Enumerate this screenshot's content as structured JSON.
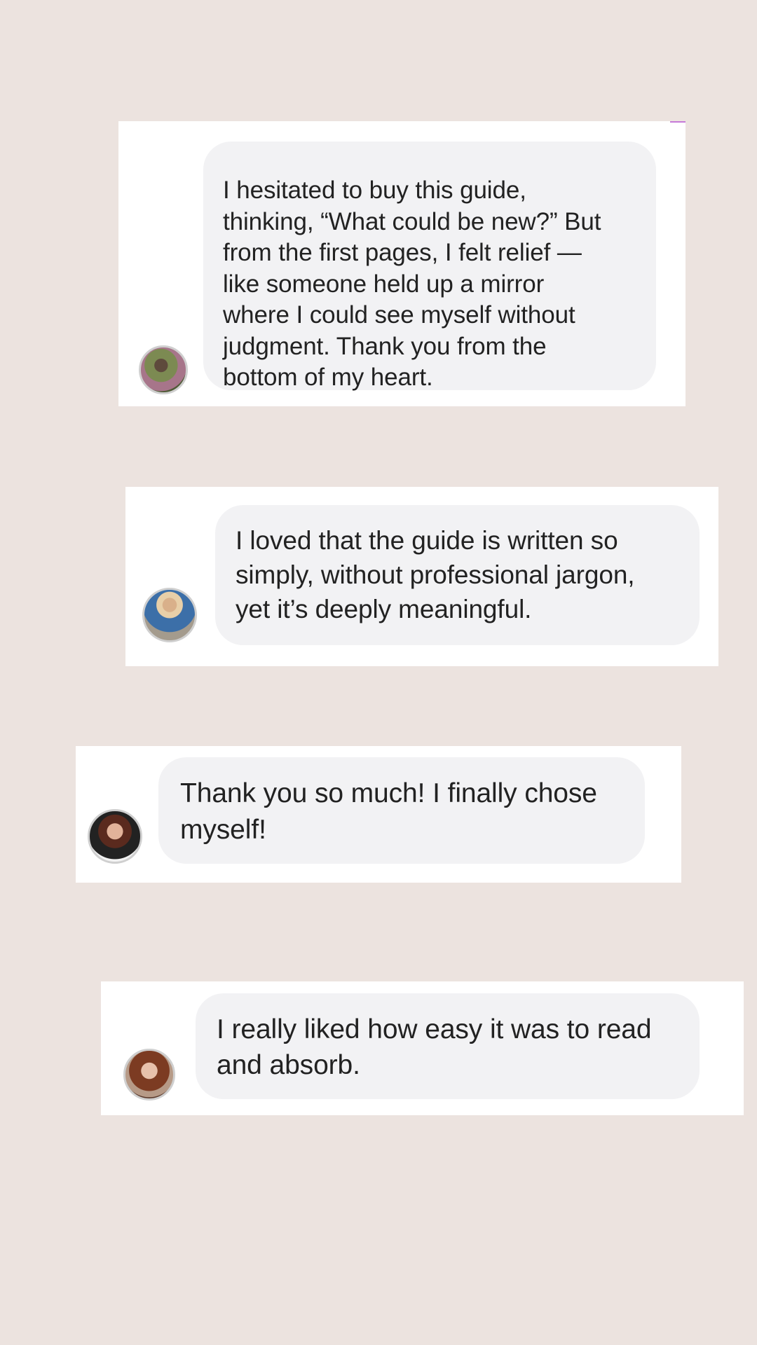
{
  "messages": [
    {
      "avatar_icon": "user-avatar-icon",
      "lines": [
        "I hesitated to buy this guide,",
        "thinking, “What could be new?” But",
        "from the first pages, I felt relief —",
        "like someone held up a mirror",
        "where I could see myself without",
        "judgment. Thank you from the",
        "bottom of my heart."
      ]
    },
    {
      "avatar_icon": "user-avatar-icon",
      "lines": [
        "I loved that the guide is written so",
        "simply, without professional jargon,",
        "yet it’s deeply meaningful."
      ]
    },
    {
      "avatar_icon": "user-avatar-icon",
      "lines": [
        "Thank you so much! I finally chose",
        "myself!"
      ]
    },
    {
      "avatar_icon": "user-avatar-icon",
      "lines": [
        "I really liked how easy it was to read",
        "and absorb."
      ]
    }
  ],
  "colors": {
    "page_background": "#ece3df",
    "card_background": "#ffffff",
    "bubble_background": "#f2f2f4",
    "text": "#222222",
    "accent": "#c67ad8"
  }
}
